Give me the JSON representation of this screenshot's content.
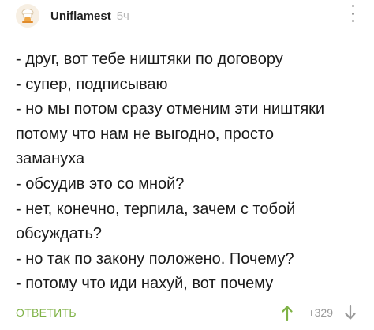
{
  "comment": {
    "author": "Uniflamest",
    "time": "5ч",
    "avatar_icon": "chef-avatar-icon",
    "lines": [
      "- друг, вот тебе ништяки по договору",
      "- супер, подписываю",
      "- но мы потом сразу отменим эти ништяки",
      "потому что нам не выгодно, просто",
      "замануха",
      "- обсудив это со мной?",
      "- нет, конечно, терпила, зачем с тобой",
      "обсуждать?",
      "- но так по закону положено. Почему?",
      "- потому что иди нахуй, вот почему"
    ],
    "reply_label": "ОТВЕТИТЬ",
    "rating": "+329"
  },
  "colors": {
    "accent_green": "#7fb246",
    "muted_gray": "#9a9a9a",
    "text": "#1b1b1b"
  }
}
